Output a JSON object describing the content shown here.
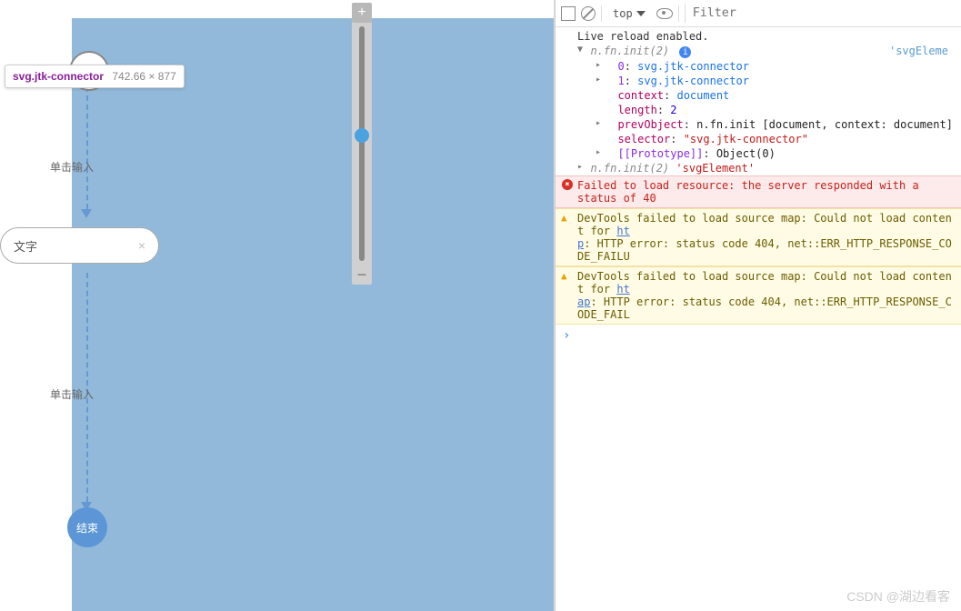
{
  "canvas": {
    "tooltip_selector": "svg.jtk-connector",
    "tooltip_dims": "742.66 × 877",
    "label_input": "单击输入",
    "text_node": "文字",
    "end_node": "结束"
  },
  "zoom": {
    "plus": "+",
    "minus": "−"
  },
  "toolbar": {
    "context": "top",
    "filter_placeholder": "Filter"
  },
  "console": {
    "live_reload": "Live reload enabled.",
    "obj_header": "n.fn.init(2)",
    "item0_idx": "0",
    "item0_val": "svg.jtk-connector",
    "item1_idx": "1",
    "item1_val": "svg.jtk-connector",
    "ctx_key": "context",
    "ctx_val": "document",
    "len_key": "length",
    "len_val": "2",
    "prev_key": "prevObject",
    "prev_val": "n.fn.init [document, context: document]",
    "sel_key": "selector",
    "sel_val": "\"svg.jtk-connector\"",
    "proto_key": "[[Prototype]]",
    "proto_val": "Object(0)",
    "obj2_header": "n.fn.init(2)",
    "obj2_tag": "'svgElement'",
    "src_tag": "'svgEleme",
    "error": "Failed to load resource: the server responded with a status of 40",
    "warn1a": "DevTools failed to load source map: Could not load content for ",
    "warn1b": ": HTTP error: status code 404, net::ERR_HTTP_RESPONSE_CODE_FAILU",
    "warn1_u1": "ht",
    "warn1_u2": "p",
    "warn2a": "DevTools failed to load source map: Could not load content for ",
    "warn2b": ": HTTP error: status code 404, net::ERR_HTTP_RESPONSE_CODE_FAIL",
    "warn2_u1": "ht",
    "warn2_u2": "ap",
    "prompt": "›"
  },
  "watermark": "CSDN @湖边看客"
}
